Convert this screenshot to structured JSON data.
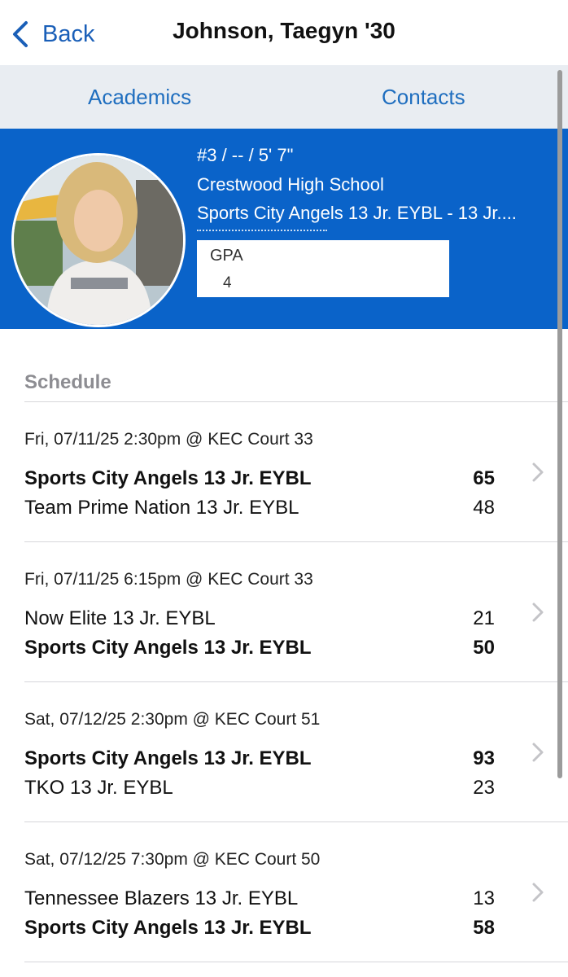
{
  "nav": {
    "back_label": "Back",
    "title": "Johnson, Taegyn '30"
  },
  "tabs": [
    {
      "label": "Academics"
    },
    {
      "label": "Contacts"
    }
  ],
  "profile": {
    "line1": "#3 / -- / 5' 7\"",
    "school": "Crestwood High School",
    "team": "Sports City Angels 13 Jr. EYBL - 13 Jr....",
    "gpa_label": "GPA",
    "gpa_value": "4"
  },
  "schedule": {
    "title": "Schedule",
    "games": [
      {
        "datetime": "Fri, 07/11/25 2:30pm @ KEC Court 33",
        "team1": "Sports City Angels 13 Jr. EYBL",
        "score1": "65",
        "team2": "Team Prime Nation 13 Jr. EYBL",
        "score2": "48",
        "winner": 1
      },
      {
        "datetime": "Fri, 07/11/25 6:15pm @ KEC Court 33",
        "team1": "Now Elite 13 Jr. EYBL",
        "score1": "21",
        "team2": "Sports City Angels 13 Jr. EYBL",
        "score2": "50",
        "winner": 2
      },
      {
        "datetime": "Sat, 07/12/25 2:30pm @ KEC Court 51",
        "team1": "Sports City Angels 13 Jr. EYBL",
        "score1": "93",
        "team2": "TKO 13 Jr. EYBL",
        "score2": "23",
        "winner": 1
      },
      {
        "datetime": "Sat, 07/12/25 7:30pm @ KEC Court 50",
        "team1": "Tennessee Blazers 13 Jr. EYBL",
        "score1": "13",
        "team2": "Sports City Angels 13 Jr. EYBL",
        "score2": "58",
        "winner": 2
      }
    ]
  },
  "colors": {
    "accent": "#0a63c9",
    "link": "#1f6ebf",
    "tab_bar": "#e9edf2"
  },
  "icons": {
    "back": "chevron-left-icon",
    "row": "chevron-right-icon"
  }
}
